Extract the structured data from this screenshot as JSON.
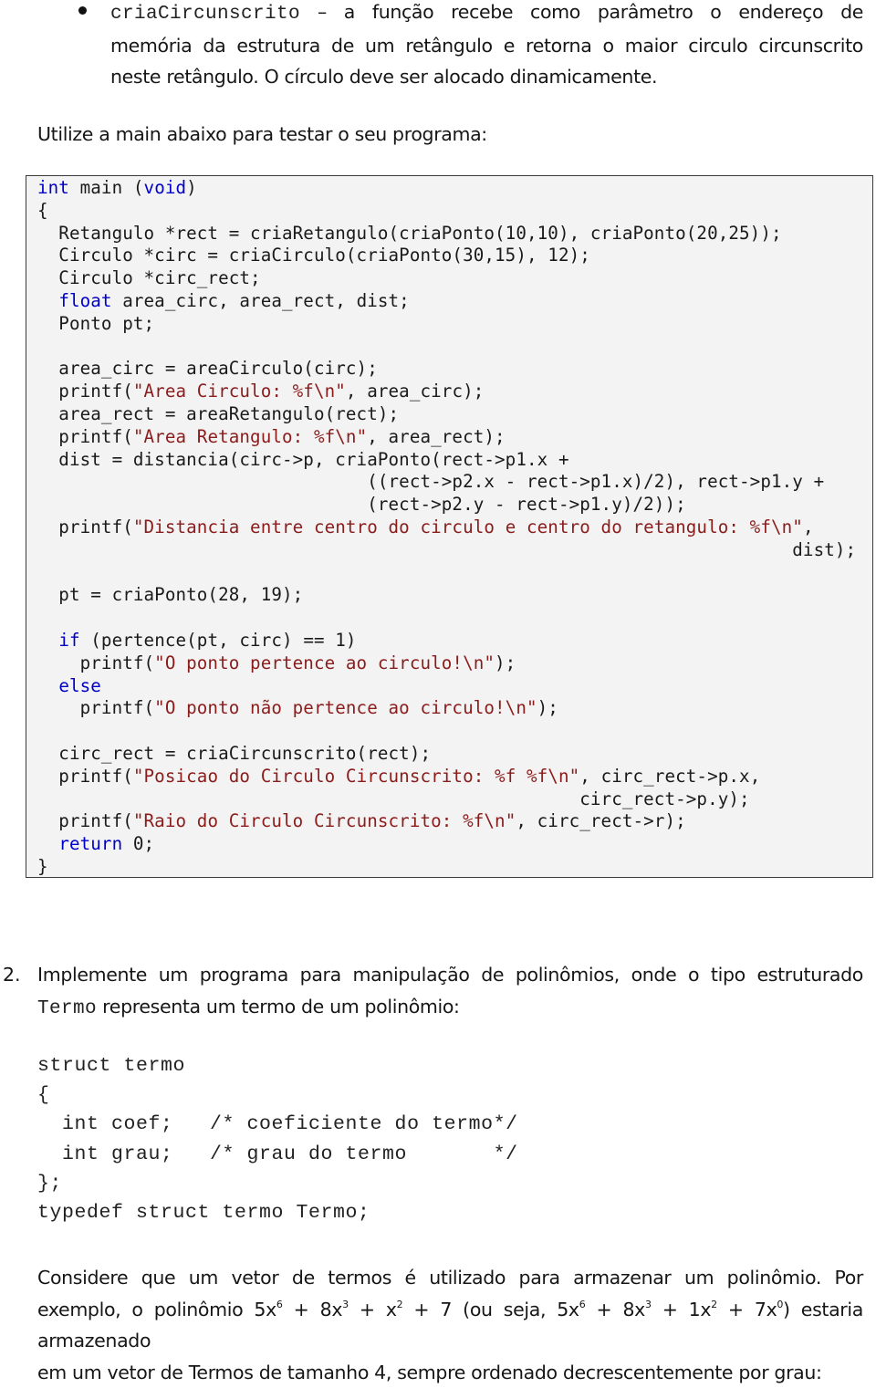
{
  "bullet": {
    "function_name": "criaCircunscrito",
    "dash": "–",
    "line1_rest": "a função recebe como parâmetro o endereço de",
    "line2": "memória da estrutura de um retângulo e retorna o maior circulo circunscrito",
    "line3": "neste retângulo. O círculo deve ser alocado dinamicamente."
  },
  "intro": "Utilize a main abaixo para testar o seu programa:",
  "main_code": {
    "lines": [
      [
        {
          "t": "int",
          "c": "kw"
        },
        {
          "t": " main ("
        },
        {
          "t": "void",
          "c": "kw"
        },
        {
          "t": ")"
        }
      ],
      [
        {
          "t": "{"
        }
      ],
      [
        {
          "t": "  Retangulo *rect = criaRetangulo(criaPonto(10,10), criaPonto(20,25));"
        }
      ],
      [
        {
          "t": "  Circulo *circ = criaCirculo(criaPonto(30,15), 12);"
        }
      ],
      [
        {
          "t": "  Circulo *circ_rect;"
        }
      ],
      [
        {
          "t": "  "
        },
        {
          "t": "float",
          "c": "kw"
        },
        {
          "t": " area_circ, area_rect, dist;"
        }
      ],
      [
        {
          "t": "  Ponto pt;"
        }
      ],
      [
        {
          "t": ""
        }
      ],
      [
        {
          "t": "  area_circ = areaCirculo(circ);"
        }
      ],
      [
        {
          "t": "  printf("
        },
        {
          "t": "\"Area Circulo: %f\\n\"",
          "c": "str"
        },
        {
          "t": ", area_circ);"
        }
      ],
      [
        {
          "t": "  area_rect = areaRetangulo(rect);"
        }
      ],
      [
        {
          "t": "  printf("
        },
        {
          "t": "\"Area Retangulo: %f\\n\"",
          "c": "str"
        },
        {
          "t": ", area_rect);"
        }
      ],
      [
        {
          "t": "  dist = distancia(circ->p, criaPonto(rect->p1.x +"
        }
      ],
      [
        {
          "t": "                               ((rect->p2.x - rect->p1.x)/2), rect->p1.y +"
        }
      ],
      [
        {
          "t": "                               (rect->p2.y - rect->p1.y)/2));"
        }
      ],
      [
        {
          "t": "  printf("
        },
        {
          "t": "\"Distancia entre centro do circulo e centro do retangulo: %f\\n\"",
          "c": "str"
        },
        {
          "t": ","
        }
      ],
      [
        {
          "t": "                                                                       dist);"
        }
      ],
      [
        {
          "t": ""
        }
      ],
      [
        {
          "t": "  pt = criaPonto(28, 19);"
        }
      ],
      [
        {
          "t": ""
        }
      ],
      [
        {
          "t": "  "
        },
        {
          "t": "if",
          "c": "kw"
        },
        {
          "t": " (pertence(pt, circ) == 1)"
        }
      ],
      [
        {
          "t": "    printf("
        },
        {
          "t": "\"O ponto pertence ao circulo!\\n\"",
          "c": "str"
        },
        {
          "t": ");"
        }
      ],
      [
        {
          "t": "  "
        },
        {
          "t": "else",
          "c": "kw"
        }
      ],
      [
        {
          "t": "    printf("
        },
        {
          "t": "\"O ponto não pertence ao circulo!\\n\"",
          "c": "str"
        },
        {
          "t": ");"
        }
      ],
      [
        {
          "t": ""
        }
      ],
      [
        {
          "t": "  circ_rect = criaCircunscrito(rect);"
        }
      ],
      [
        {
          "t": "  printf("
        },
        {
          "t": "\"Posicao do Circulo Circunscrito: %f %f\\n\"",
          "c": "str"
        },
        {
          "t": ", circ_rect->p.x,"
        }
      ],
      [
        {
          "t": "                                                   circ_rect->p.y);"
        }
      ],
      [
        {
          "t": "  printf("
        },
        {
          "t": "\"Raio do Circulo Circunscrito: %f\\n\"",
          "c": "str"
        },
        {
          "t": ", circ_rect->r);"
        }
      ],
      [
        {
          "t": "  "
        },
        {
          "t": "return",
          "c": "kw"
        },
        {
          "t": " 0;"
        }
      ],
      [
        {
          "t": "}"
        }
      ]
    ]
  },
  "question2": {
    "number": "2.",
    "line1": "Implemente um programa para manipulação de polinômios, onde o tipo estruturado",
    "type_name": "Termo",
    "line2_rest": " representa um termo de um polinômio:"
  },
  "struct_code": {
    "lines": [
      "struct termo",
      "{",
      "  int coef;   /* coeficiente do termo*/",
      "  int grau;   /* grau do termo       */",
      "};",
      "typedef struct termo Termo;"
    ]
  },
  "consider": {
    "line1": "Considere que um vetor de termos é utilizado para armazenar um polinômio. Por",
    "line2_prefix": "exemplo, o polinômio ",
    "poly_a": [
      {
        "coef": "5x",
        "exp": "6",
        "sep": " + "
      },
      {
        "coef": "8x",
        "exp": "3",
        "sep": " + "
      },
      {
        "coef": "x",
        "exp": "2",
        "sep": " + 7"
      }
    ],
    "line2_mid": " (ou seja, ",
    "poly_b": [
      {
        "coef": "5x",
        "exp": "6",
        "sep": " + "
      },
      {
        "coef": "8x",
        "exp": "3",
        "sep": " + "
      },
      {
        "coef": "1x",
        "exp": "2",
        "sep": " + "
      },
      {
        "coef": "7x",
        "exp": "0",
        "sep": ""
      }
    ],
    "line2_suffix": ") estaria armazenado",
    "line3": "em um vetor de Termos de tamanho 4, sempre ordenado decrescentemente por grau:"
  },
  "colors": {
    "keyword": "#0000c8",
    "string": "#8b1c1c",
    "code_background": "#f3f3f3"
  }
}
